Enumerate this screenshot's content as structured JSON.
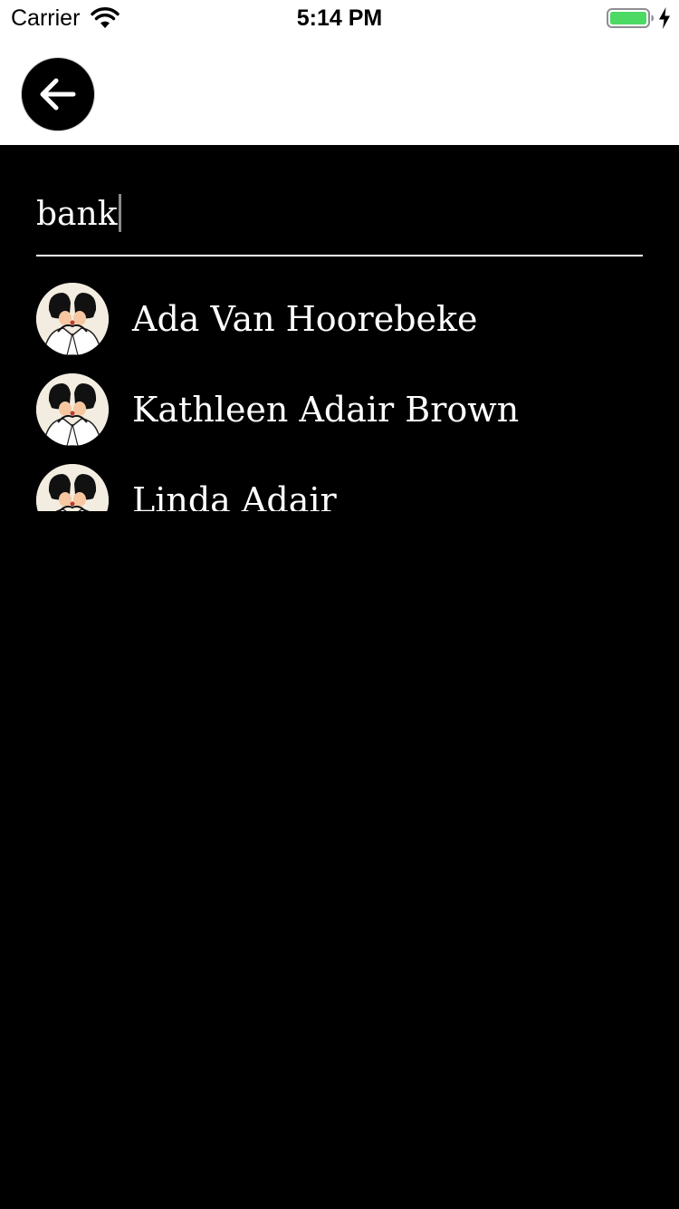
{
  "status_bar": {
    "carrier": "Carrier",
    "time": "5:14 PM",
    "battery_color": "#4cd964"
  },
  "header": {
    "back_icon": "arrow-left-icon"
  },
  "search": {
    "value": "bank"
  },
  "results": [
    {
      "name": "Ada Van Hoorebeke",
      "avatar": "avatar-image"
    },
    {
      "name": "Kathleen Adair Brown",
      "avatar": "avatar-image"
    },
    {
      "name": "Linda Adair",
      "avatar": "avatar-image"
    }
  ],
  "colors": {
    "background": "#000000",
    "header_background": "#ffffff",
    "text": "#ffffff"
  }
}
